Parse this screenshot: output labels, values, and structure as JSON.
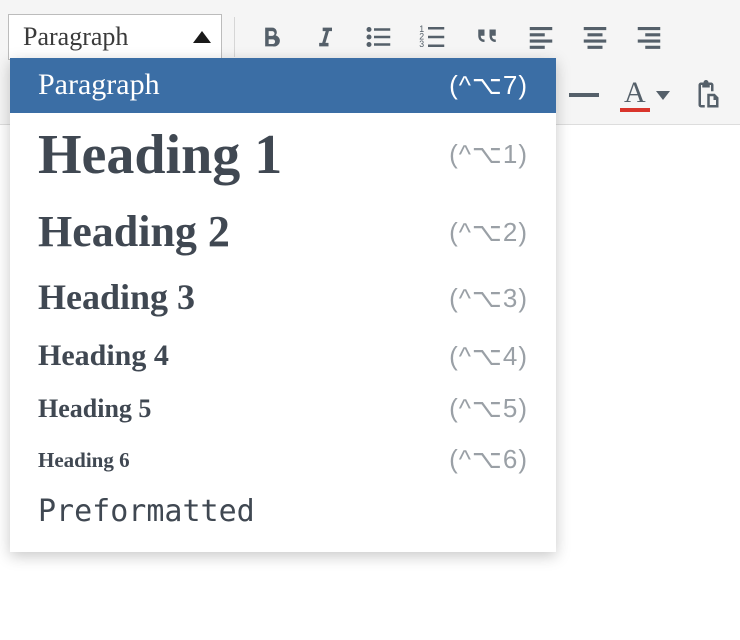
{
  "format_select": {
    "current": "Paragraph"
  },
  "dropdown": {
    "items": [
      {
        "label": "Paragraph",
        "shortcut": "(^⌥7)",
        "cls": "dd-paragraph",
        "selected": true
      },
      {
        "label": "Heading 1",
        "shortcut": "(^⌥1)",
        "cls": "dd-h1",
        "selected": false
      },
      {
        "label": "Heading 2",
        "shortcut": "(^⌥2)",
        "cls": "dd-h2",
        "selected": false
      },
      {
        "label": "Heading 3",
        "shortcut": "(^⌥3)",
        "cls": "dd-h3",
        "selected": false
      },
      {
        "label": "Heading 4",
        "shortcut": "(^⌥4)",
        "cls": "dd-h4",
        "selected": false
      },
      {
        "label": "Heading 5",
        "shortcut": "(^⌥5)",
        "cls": "dd-h5",
        "selected": false
      },
      {
        "label": "Heading 6",
        "shortcut": "(^⌥6)",
        "cls": "dd-h6",
        "selected": false
      },
      {
        "label": "Preformatted",
        "shortcut": "",
        "cls": "dd-pre",
        "selected": false
      }
    ]
  },
  "text_color": {
    "letter": "A",
    "swatch": "#d9352c"
  }
}
